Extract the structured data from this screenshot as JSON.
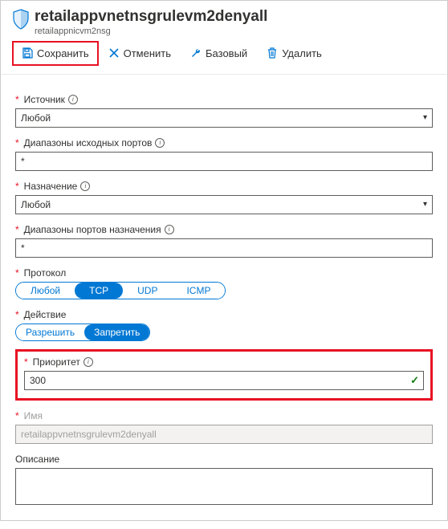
{
  "header": {
    "title": "retailappvnetnsgrulevm2denyall",
    "subtitle": "retailappnicvm2nsg"
  },
  "toolbar": {
    "save": "Сохранить",
    "cancel": "Отменить",
    "basic": "Базовый",
    "delete": "Удалить"
  },
  "form": {
    "source": {
      "label": "Источник",
      "value": "Любой"
    },
    "sourcePorts": {
      "label": "Диапазоны исходных портов",
      "value": "*"
    },
    "destination": {
      "label": "Назначение",
      "value": "Любой"
    },
    "destPorts": {
      "label": "Диапазоны портов назначения",
      "value": "*"
    },
    "protocol": {
      "label": "Протокол",
      "options": {
        "any": "Любой",
        "tcp": "TCP",
        "udp": "UDP",
        "icmp": "ICMP"
      },
      "selected": "tcp"
    },
    "action": {
      "label": "Действие",
      "options": {
        "allow": "Разрешить",
        "deny": "Запретить"
      },
      "selected": "deny"
    },
    "priority": {
      "label": "Приоритет",
      "value": "300"
    },
    "name": {
      "label": "Имя",
      "value": "retailappvnetnsgrulevm2denyall"
    },
    "description": {
      "label": "Описание",
      "value": ""
    }
  }
}
